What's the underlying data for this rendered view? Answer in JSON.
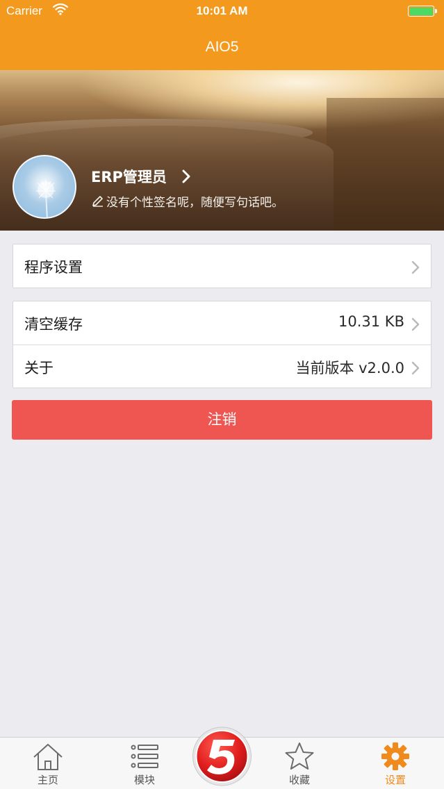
{
  "status_bar": {
    "carrier": "Carrier",
    "time": "10:01 AM"
  },
  "nav": {
    "title": "AIO5"
  },
  "profile": {
    "name": "ERP管理员",
    "signature": "没有个性签名呢，随便写句话吧。"
  },
  "settings": {
    "group1": [
      {
        "label": "程序设置",
        "value": ""
      }
    ],
    "group2": [
      {
        "label": "清空缓存",
        "value": "10.31 KB"
      },
      {
        "label": "关于",
        "value": "当前版本 v2.0.0"
      }
    ]
  },
  "logout_label": "注销",
  "colors": {
    "brand": "#f39a1e",
    "logout": "#ef5551",
    "active_tab": "#f08a1c",
    "battery": "#4cd964"
  },
  "tabs": [
    {
      "label": "主页",
      "icon": "home-icon",
      "active": false
    },
    {
      "label": "模块",
      "icon": "list-icon",
      "active": false
    },
    {
      "label": "",
      "icon": "brand-5-logo-icon",
      "active": false
    },
    {
      "label": "收藏",
      "icon": "star-icon",
      "active": false
    },
    {
      "label": "设置",
      "icon": "gear-icon",
      "active": true
    }
  ]
}
